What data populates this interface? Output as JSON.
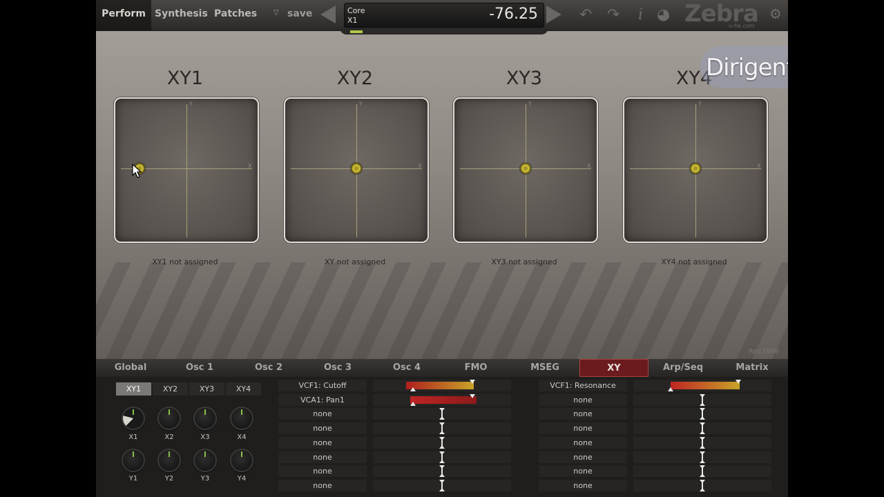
{
  "nav": {
    "perform": "Perform",
    "synthesis": "Synthesis",
    "patches": "Patches",
    "save": "save"
  },
  "display": {
    "line1": "Core",
    "line2": "X1",
    "value": "-76.25"
  },
  "logo": {
    "name": "Zebra",
    "sub": "u-he.com"
  },
  "watermark": "Dirigent",
  "pads": [
    {
      "title": "XY1",
      "assign": "XY1 not assigned",
      "x": -0.68,
      "y": 0.0
    },
    {
      "title": "XY2",
      "assign": "XY not assigned",
      "x": 0.0,
      "y": 0.0
    },
    {
      "title": "XY3",
      "assign": "XY3 not assigned",
      "x": 0.0,
      "y": 0.0
    },
    {
      "title": "XY4",
      "assign": "XY4 not assigned",
      "x": 0.0,
      "y": 0.0
    }
  ],
  "rev": "Rev3898",
  "tabs": [
    "Global",
    "Osc 1",
    "Osc 2",
    "Osc 3",
    "Osc 4",
    "FMO",
    "MSEG",
    "XY",
    "Arp/Seq",
    "Matrix"
  ],
  "active_tab": "XY",
  "xy_buttons": [
    "XY1",
    "XY2",
    "XY3",
    "XY4"
  ],
  "dials_x": [
    "X1",
    "X2",
    "X3",
    "X4"
  ],
  "dials_y": [
    "Y1",
    "Y2",
    "Y3",
    "Y4"
  ],
  "x_targets": [
    "VCF1: Cutoff",
    "VCA1: Pan1",
    "none",
    "none",
    "none",
    "none",
    "none",
    "none"
  ],
  "y_targets": [
    "VCF1: Resonance",
    "none",
    "none",
    "none",
    "none",
    "none",
    "none",
    "none"
  ]
}
